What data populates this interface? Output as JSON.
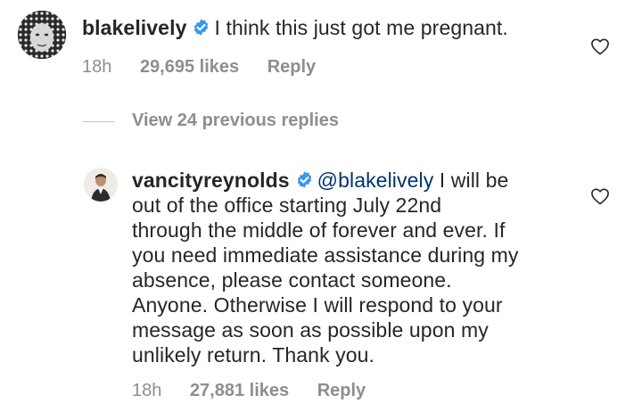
{
  "comment1": {
    "username": "blakelively",
    "text": "I think this just got me pregnant.",
    "time": "18h",
    "likes": "29,695 likes",
    "reply_label": "Reply",
    "verified_icon": "verified-badge-icon",
    "like_icon": "heart-outline-icon"
  },
  "view_previous": {
    "label": "View 24 previous replies"
  },
  "comment2": {
    "username": "vancityreynolds",
    "mention": "@blakelively",
    "lines": [
      "I will be",
      "out of the office starting July 22nd",
      "through the middle of forever and ever. If",
      "you need immediate assistance during my",
      "absence, please contact someone.",
      "Anyone. Otherwise I will respond to your",
      "message as soon as possible upon my",
      "unlikely return. Thank you."
    ],
    "time": "18h",
    "likes": "27,881 likes",
    "reply_label": "Reply",
    "verified_icon": "verified-badge-icon",
    "like_icon": "heart-outline-icon"
  },
  "colors": {
    "text": "#262626",
    "meta": "#8e8e8e",
    "mention": "#003569",
    "verified": "#3897f0"
  }
}
